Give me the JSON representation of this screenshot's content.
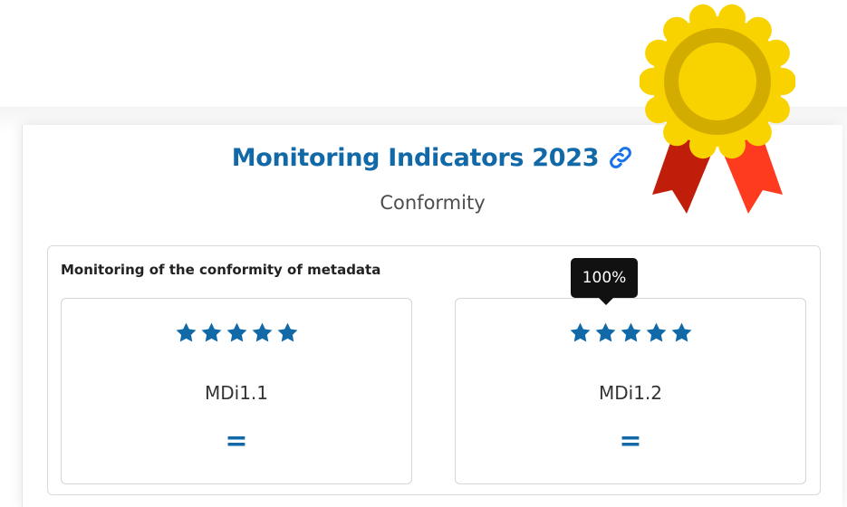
{
  "header": {
    "title": "Monitoring Indicators 2023",
    "link_icon": "link-icon",
    "subtitle": "Conformity"
  },
  "section": {
    "label": "Monitoring of the conformity of metadata",
    "indicators": [
      {
        "name": "MDi1.1",
        "stars": 5,
        "max_stars": 5,
        "trend": "="
      },
      {
        "name": "MDi1.2",
        "stars": 5,
        "max_stars": 5,
        "trend": "="
      }
    ]
  },
  "tooltip": {
    "text": "100%"
  },
  "badge": {
    "icon": "award-ribbon-icon"
  },
  "colors": {
    "accent": "#1169a7",
    "star": "#1169a7",
    "badge_gold": "#f9d300",
    "badge_inner": "#d2ad00",
    "ribbon_left": "#c01d0b",
    "ribbon_right": "#ff3b1f"
  }
}
